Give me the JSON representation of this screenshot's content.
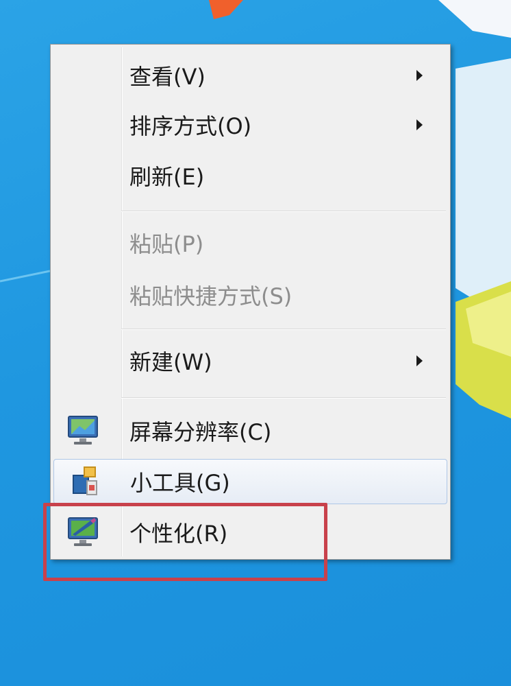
{
  "menu": {
    "items": [
      {
        "label": "查看(V)",
        "submenu": true,
        "disabled": false
      },
      {
        "label": "排序方式(O)",
        "submenu": true,
        "disabled": false
      },
      {
        "label": "刷新(E)",
        "submenu": false,
        "disabled": false
      },
      {
        "label": "粘贴(P)",
        "submenu": false,
        "disabled": true
      },
      {
        "label": "粘贴快捷方式(S)",
        "submenu": false,
        "disabled": true
      },
      {
        "label": "新建(W)",
        "submenu": true,
        "disabled": false
      },
      {
        "label": "屏幕分辨率(C)",
        "submenu": false,
        "disabled": false,
        "icon": "screen-resolution-icon"
      },
      {
        "label": "小工具(G)",
        "submenu": false,
        "disabled": false,
        "icon": "gadgets-icon",
        "hovered": true
      },
      {
        "label": "个性化(R)",
        "submenu": false,
        "disabled": false,
        "icon": "personalize-icon",
        "highlighted": true
      }
    ]
  },
  "colors": {
    "desktop": "#1f97e0",
    "menu_bg": "#f0f0f0",
    "highlight_border": "#c8414b",
    "disabled_text": "#8d8d8d"
  }
}
